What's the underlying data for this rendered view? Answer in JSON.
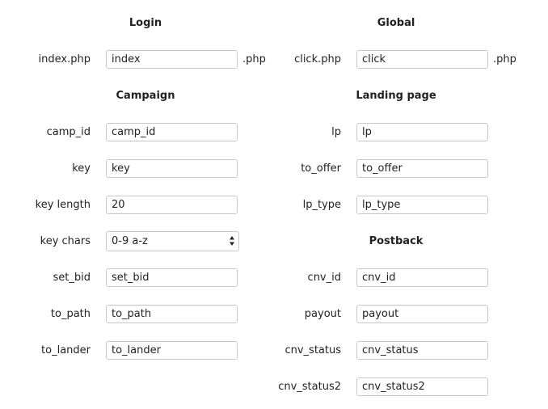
{
  "login": {
    "title": "Login",
    "index_label": "index.php",
    "index_value": "index",
    "index_suffix": ".php"
  },
  "global": {
    "title": "Global",
    "click_label": "click.php",
    "click_value": "click",
    "click_suffix": ".php"
  },
  "campaign": {
    "title": "Campaign",
    "camp_id": {
      "label": "camp_id",
      "value": "camp_id"
    },
    "key": {
      "label": "key",
      "value": "key"
    },
    "key_length": {
      "label": "key length",
      "value": "20"
    },
    "key_chars": {
      "label": "key chars",
      "selected": "0-9 a-z"
    },
    "set_bid": {
      "label": "set_bid",
      "value": "set_bid"
    },
    "to_path": {
      "label": "to_path",
      "value": "to_path"
    },
    "to_lander": {
      "label": "to_lander",
      "value": "to_lander"
    }
  },
  "landing_page": {
    "title": "Landing page",
    "lp": {
      "label": "lp",
      "value": "lp"
    },
    "to_offer": {
      "label": "to_offer",
      "value": "to_offer"
    },
    "lp_type": {
      "label": "lp_type",
      "value": "lp_type"
    }
  },
  "postback": {
    "title": "Postback",
    "cnv_id": {
      "label": "cnv_id",
      "value": "cnv_id"
    },
    "payout": {
      "label": "payout",
      "value": "payout"
    },
    "cnv_status": {
      "label": "cnv_status",
      "value": "cnv_status"
    },
    "cnv_status2": {
      "label": "cnv_status2",
      "value": "cnv_status2"
    }
  },
  "icons": {
    "select_arrows": "up-down-chevron-icon"
  }
}
